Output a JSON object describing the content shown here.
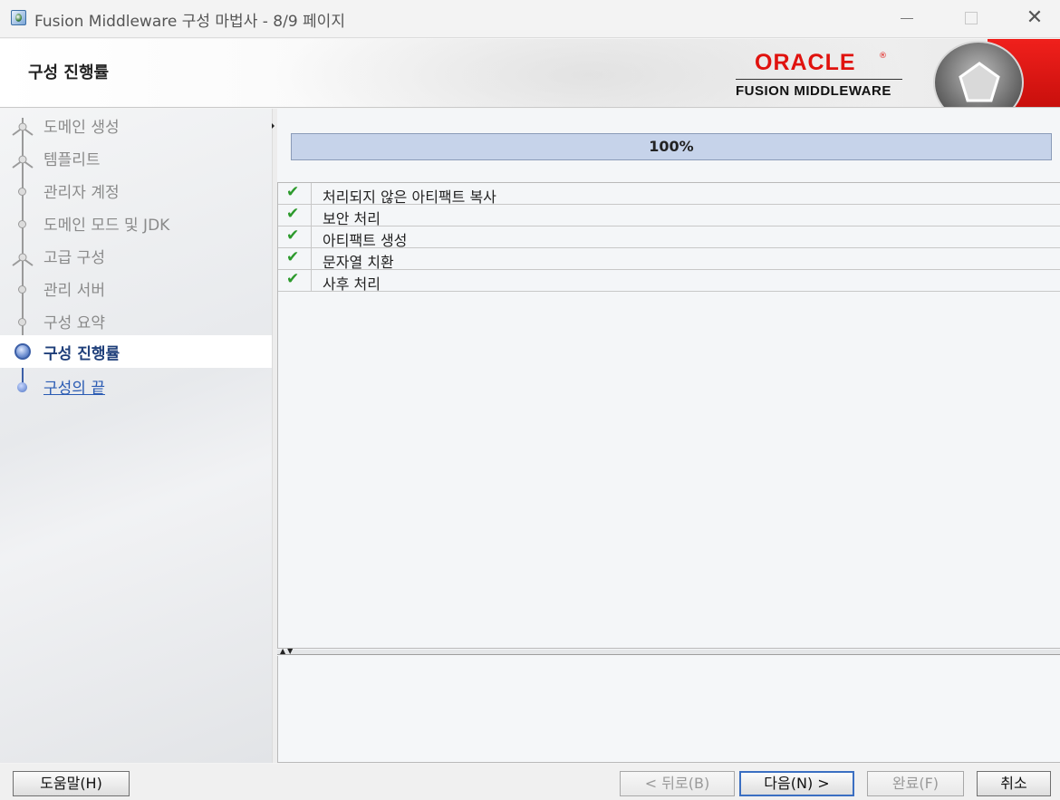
{
  "window": {
    "title": "Fusion Middleware 구성 마법사 - 8/9 페이지",
    "controls": {
      "minimize": "—",
      "maximize": "□",
      "close": "✕"
    }
  },
  "header": {
    "page_title": "구성 진행률",
    "brand_top": "ORACLE",
    "brand_registered": "®",
    "brand_bottom": "FUSION MIDDLEWARE",
    "accent_color": "#e0120e"
  },
  "nav": {
    "steps": [
      {
        "label": "도메인 생성",
        "state": "done",
        "icon": "person-node-icon"
      },
      {
        "label": "템플리트",
        "state": "done",
        "icon": "person-node-icon"
      },
      {
        "label": "관리자 계정",
        "state": "done",
        "icon": "dot-node-icon"
      },
      {
        "label": "도메인 모드 및 JDK",
        "state": "done",
        "icon": "dot-node-icon"
      },
      {
        "label": "고급 구성",
        "state": "done",
        "icon": "person-node-icon"
      },
      {
        "label": "관리 서버",
        "state": "done",
        "icon": "dot-node-icon"
      },
      {
        "label": "구성 요약",
        "state": "done",
        "icon": "dot-node-icon"
      },
      {
        "label": "구성 진행률",
        "state": "current",
        "icon": "current-node-icon"
      },
      {
        "label": "구성의 끝",
        "state": "next",
        "icon": "blue-dot-node-icon"
      }
    ]
  },
  "progress": {
    "percent": 100,
    "label": "100%"
  },
  "tasks": [
    {
      "status": "done",
      "icon": "check-icon",
      "label": "처리되지 않은 아티팩트 복사"
    },
    {
      "status": "done",
      "icon": "check-icon",
      "label": "보안 처리"
    },
    {
      "status": "done",
      "icon": "check-icon",
      "label": "아티팩트 생성"
    },
    {
      "status": "done",
      "icon": "check-icon",
      "label": "문자열 치환"
    },
    {
      "status": "done",
      "icon": "check-icon",
      "label": "사후 처리"
    }
  ],
  "buttons": {
    "help": "도움말(H)",
    "back": "< 뒤로(B)",
    "next": "다음(N) >",
    "finish": "완료(F)",
    "cancel": "취소"
  },
  "button_states": {
    "back_enabled": false,
    "next_enabled": true,
    "finish_enabled": false
  }
}
